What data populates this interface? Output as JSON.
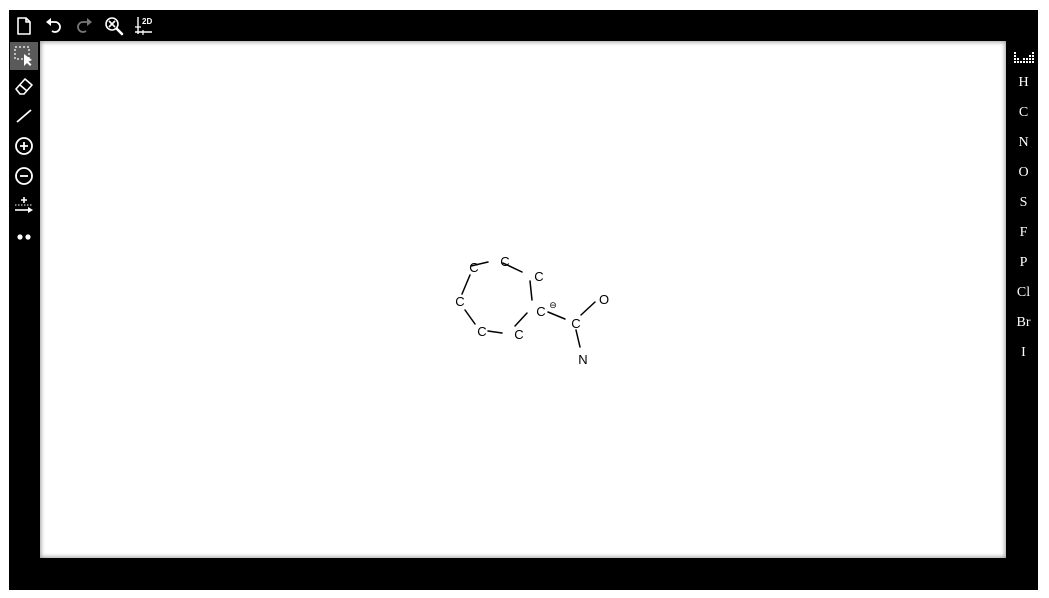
{
  "toolbar": {
    "top": [
      "new-file-icon",
      "undo-icon",
      "redo-icon",
      "clear-zoom-icon",
      "clean-2d-icon"
    ],
    "clean_2d_label": "2D",
    "left": [
      "select-icon",
      "eraser-icon",
      "bond-icon",
      "positive-charge-icon",
      "negative-charge-icon",
      "bond-order-icon",
      "lone-pair-icon"
    ]
  },
  "periodic_table_icon": "periodic-table-icon",
  "elements": [
    "H",
    "C",
    "N",
    "O",
    "S",
    "F",
    "P",
    "Cl",
    "Br",
    "I"
  ],
  "molecule": {
    "atoms": {
      "c1": "C",
      "c2": "C",
      "c3": "C",
      "c4": "C",
      "c5": "C",
      "c6": "C",
      "c7": "C",
      "carbonyl_c": "C",
      "o": "O",
      "n": "N"
    },
    "charge_symbol": "⊖"
  },
  "colors": {
    "background": "#000000",
    "canvas": "#ffffff",
    "active_tool": "#5a5a5a",
    "icon": "#ffffff"
  }
}
